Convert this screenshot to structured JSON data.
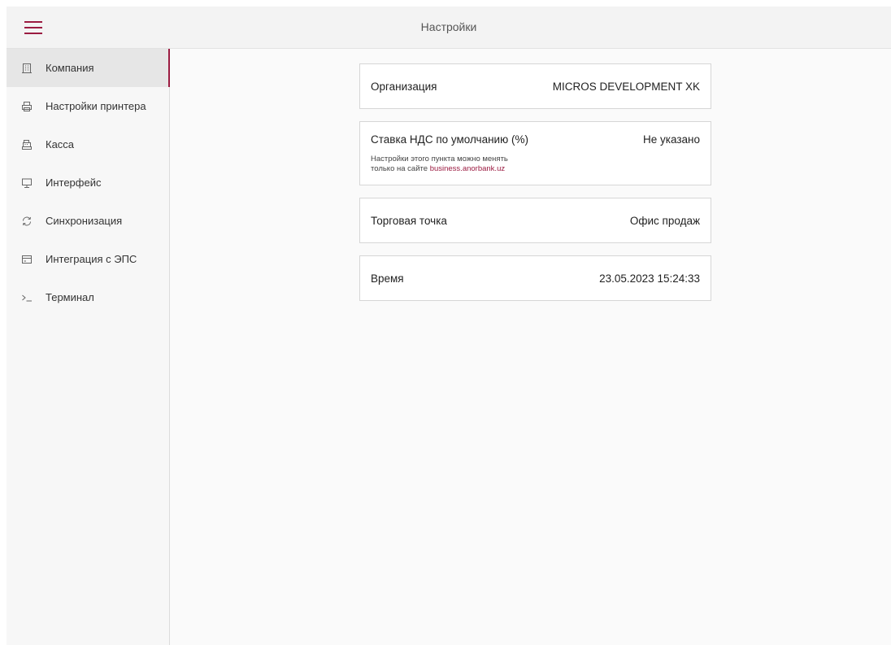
{
  "header": {
    "title": "Настройки",
    "menu_icon": "hamburger-menu-icon",
    "accent_color": "#9b1b41"
  },
  "sidebar": {
    "items": [
      {
        "label": "Компания",
        "icon": "building-icon",
        "active": true
      },
      {
        "label": "Настройки принтера",
        "icon": "printer-icon",
        "active": false
      },
      {
        "label": "Касса",
        "icon": "cash-register-icon",
        "active": false
      },
      {
        "label": "Интерфейс",
        "icon": "monitor-icon",
        "active": false
      },
      {
        "label": "Синхронизация",
        "icon": "sync-icon",
        "active": false
      },
      {
        "label": "Интеграция с ЭПС",
        "icon": "card-icon",
        "active": false
      },
      {
        "label": "Терминал",
        "icon": "terminal-icon",
        "active": false
      }
    ]
  },
  "main": {
    "cards": [
      {
        "label": "Организация",
        "value": "MICROS DEVELOPMENT XK"
      },
      {
        "label": "Ставка НДС по умолчанию (%)",
        "value": "Не указано",
        "note_line1": "Настройки этого пункта можно менять",
        "note_line2_prefix": "только на сайте ",
        "note_link": "business.anorbank.uz"
      },
      {
        "label": "Торговая точка",
        "value": "Офис продаж"
      },
      {
        "label": "Время",
        "value": "23.05.2023 15:24:33"
      }
    ]
  }
}
